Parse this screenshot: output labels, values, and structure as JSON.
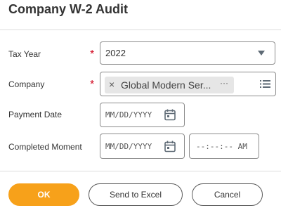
{
  "dialog": {
    "title": "Company W-2 Audit"
  },
  "form": {
    "tax_year": {
      "label": "Tax Year",
      "required_marker": "*",
      "value": "2022"
    },
    "company": {
      "label": "Company",
      "required_marker": "*",
      "selected_chip": "Global Modern Ser...",
      "chip_remove": "×",
      "chip_more": "···"
    },
    "payment_date": {
      "label": "Payment Date",
      "placeholder": "MM/DD/YYYY"
    },
    "completed_moment": {
      "label": "Completed Moment",
      "date_placeholder": "MM/DD/YYYY",
      "time_placeholder": "--:--:-- AM"
    }
  },
  "footer": {
    "ok_label": "OK",
    "excel_label": "Send to Excel",
    "cancel_label": "Cancel"
  },
  "colors": {
    "accent": "#f7a11a",
    "required": "#d0021b"
  },
  "icons": [
    "dropdown-arrow-icon",
    "close-icon",
    "ellipsis-icon",
    "list-icon",
    "calendar-icon"
  ]
}
